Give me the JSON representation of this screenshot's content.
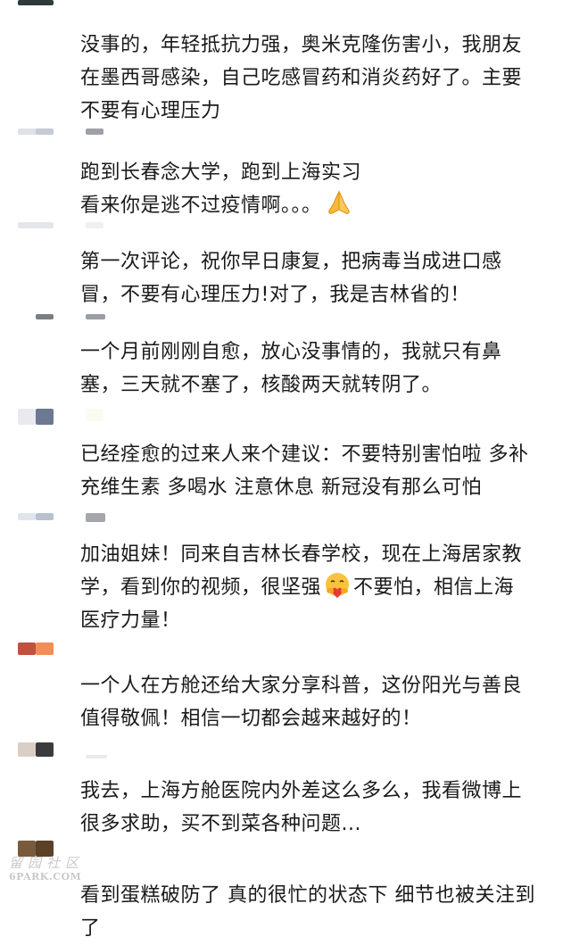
{
  "comments": [
    {
      "text": "没事的，年轻抵抗力强，奥米克隆伤害小，我朋友\n在墨西哥感染，自己吃感冒药和消炎药好了。主要\n不要有心理压力"
    },
    {
      "text": "跑到长春念大学，跑到上海实习\n看来你是逃不过疫情啊。。。",
      "emoji": "folded-hands"
    },
    {
      "text": "第一次评论，祝你早日康复，把病毒当成进口感\n冒，不要有心理压力!对了，我是吉林省的！"
    },
    {
      "text": "一个月前刚刚自愈，放心没事情的，我就只有鼻\n塞，三天就不塞了，核酸两天就转阴了。"
    },
    {
      "text": "已经痊愈的过来人来个建议：不要特别害怕啦 多补\n充维生素 多喝水 注意休息 新冠没有那么可怕"
    },
    {
      "text_before": "加油姐妹！同来自吉林长春学校，现在上海居家教\n学，看到你的视频，很坚强",
      "emoji": "hugging-heart",
      "text_after": "不要怕，相信上海\n医疗力量！"
    },
    {
      "text": "一个人在方舱还给大家分享科普，这份阳光与善良\n值得敬佩！相信一切都会越来越好的！"
    },
    {
      "text": "我去，上海方舱医院内外差这么多么，我看微博上\n很多求助，买不到菜各种问题..."
    },
    {
      "text": "看到蛋糕破防了 真的很忙的状态下 细节也被关注到\n了"
    }
  ],
  "watermark": {
    "chinese": "留园社区",
    "english": "6PARK.COM"
  },
  "colors": {
    "text": "#1a1a1a",
    "background": "#ffffff",
    "watermark": "#c9c9c9"
  }
}
